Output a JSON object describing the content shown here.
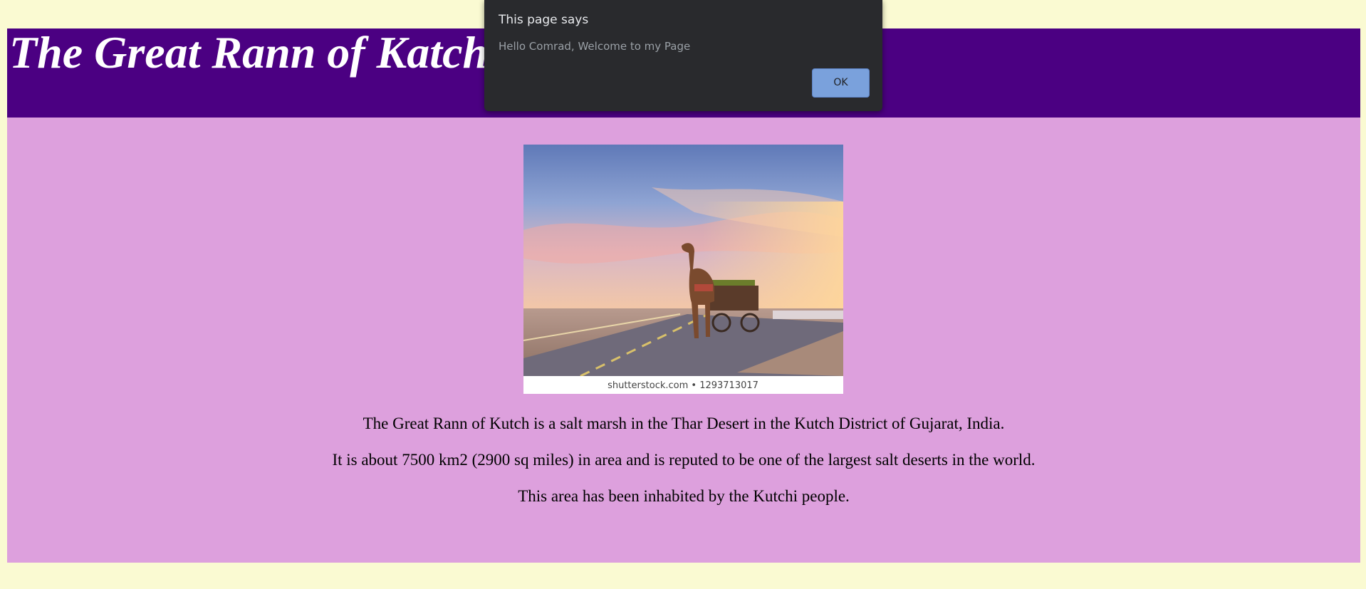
{
  "header": {
    "title": "The Great Rann of Katch"
  },
  "main": {
    "image": {
      "alt": "Camel cart on a road across the salt desert at sunset",
      "watermark": "shutterstock.com • 1293713017"
    },
    "paragraphs": [
      "The Great Rann of Kutch is a salt marsh in the Thar Desert in the Kutch District of Gujarat, India.",
      "It is about 7500 km2 (2900 sq miles) in area and is reputed to be one of the largest salt deserts in the world.",
      "This area has been inhabited by the Kutchi people."
    ]
  },
  "dialog": {
    "title": "This page says",
    "message": "Hello Comrad, Welcome to my Page",
    "ok_label": "OK"
  },
  "colors": {
    "page_background": "#fafad2",
    "header_background": "#4b0082",
    "content_background": "#dda0dd",
    "dialog_background": "#292a2d",
    "dialog_button": "#7aa1dc"
  }
}
